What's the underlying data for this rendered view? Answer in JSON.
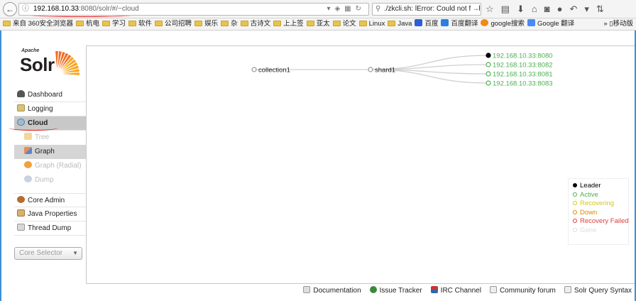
{
  "browser": {
    "url_host": "192.168.10.33",
    "url_path": ":8080/solr/#/~cloud",
    "search_text": "./zkcli.sh: lError: Could not find o",
    "toolbar_icons": [
      "star-icon",
      "clipboard-icon",
      "download-icon",
      "home-icon",
      "pocket-icon",
      "chat-icon",
      "undo-icon",
      "menu-icon"
    ],
    "bookmarks": [
      {
        "label": "来自 360安全浏览器",
        "icon": "folder"
      },
      {
        "label": "杭电",
        "icon": "folder"
      },
      {
        "label": "学习",
        "icon": "folder"
      },
      {
        "label": "软件",
        "icon": "folder"
      },
      {
        "label": "公司招聘",
        "icon": "folder"
      },
      {
        "label": "娱乐",
        "icon": "folder"
      },
      {
        "label": "杂",
        "icon": "folder"
      },
      {
        "label": "古诗文",
        "icon": "folder"
      },
      {
        "label": "上上签",
        "icon": "folder"
      },
      {
        "label": "亚太",
        "icon": "folder"
      },
      {
        "label": "论文",
        "icon": "folder"
      },
      {
        "label": "Linux",
        "icon": "folder"
      },
      {
        "label": "Java",
        "icon": "folder"
      },
      {
        "label": "百度",
        "icon": "baidu"
      },
      {
        "label": "百度翻译",
        "icon": "translate"
      },
      {
        "label": "google搜索",
        "icon": "google"
      },
      {
        "label": "Google 翻译",
        "icon": "gtranslate"
      }
    ],
    "bookmarks_more": "» ▯移动版"
  },
  "logo": {
    "apache": "Apache",
    "solr": "Solr"
  },
  "menu": {
    "dashboard": "Dashboard",
    "logging": "Logging",
    "cloud": "Cloud",
    "tree": "Tree",
    "graph": "Graph",
    "graph_radial": "Graph (Radial)",
    "dump": "Dump",
    "core_admin": "Core Admin",
    "java_properties": "Java Properties",
    "thread_dump": "Thread Dump"
  },
  "core_selector": "Core Selector",
  "graph": {
    "collection": "collection1",
    "shard": "shard1",
    "replicas": [
      {
        "label": "192.168.10.33:8080",
        "state": "leader"
      },
      {
        "label": "192.168.10.33:8082",
        "state": "active"
      },
      {
        "label": "192.168.10.33:8081",
        "state": "active"
      },
      {
        "label": "192.168.10.33:8083",
        "state": "active"
      }
    ]
  },
  "legend": [
    {
      "label": "Leader",
      "color": "#000000",
      "filled": true
    },
    {
      "label": "Active",
      "color": "#4caf50",
      "filled": false
    },
    {
      "label": "Recovering",
      "color": "#d4c817",
      "filled": false
    },
    {
      "label": "Down",
      "color": "#d98a00",
      "filled": false
    },
    {
      "label": "Recovery Failed",
      "color": "#e33b3b",
      "filled": false
    },
    {
      "label": "Gone",
      "color": "#dddddd",
      "filled": false
    }
  ],
  "footer": {
    "documentation": "Documentation",
    "issue_tracker": "Issue Tracker",
    "irc_channel": "IRC Channel",
    "community_forum": "Community forum",
    "solr_query_syntax": "Solr Query Syntax"
  },
  "colors": {
    "accent_frame": "#3b8fd6",
    "active_green": "#4caf50",
    "annotation_red": "#e01e1e"
  }
}
